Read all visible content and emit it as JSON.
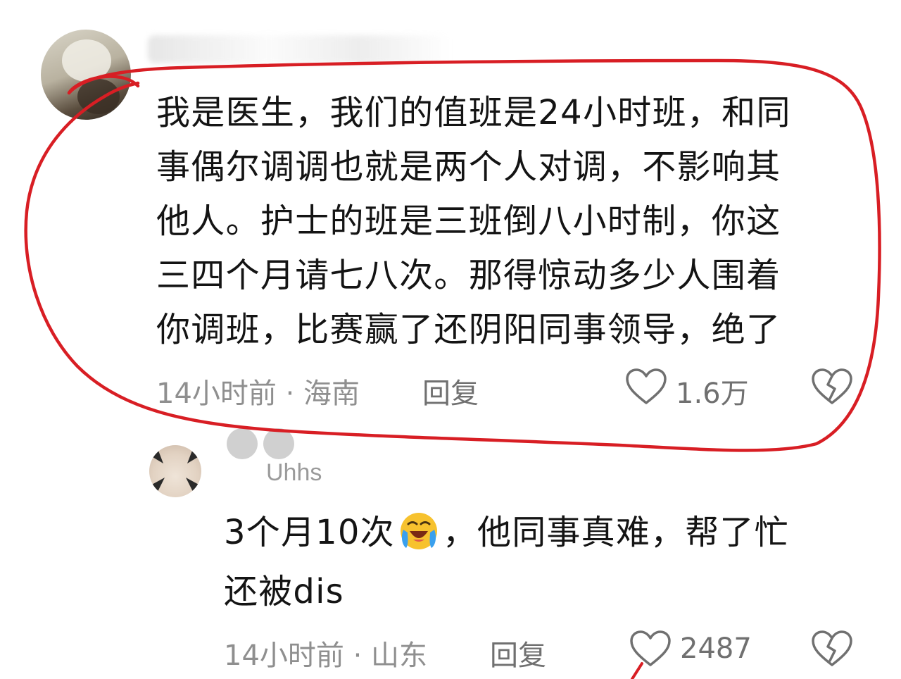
{
  "comment": {
    "lines": [
      "我是医生，我们的值班是24小时班，和同",
      "事偶尔调调也就是两个人对调，不影响其",
      "他人。护士的班是三班倒八小时制，你这",
      "三四个月请七八次。那得惊动多少人围着",
      "你调班，比赛赢了还阴阳同事领导，绝了"
    ],
    "time_location": "14小时前 · 海南",
    "reply_label": "回复",
    "like_count": "1.6万"
  },
  "reply": {
    "username_partial": "Uhhs",
    "line1_before": "3个月10次",
    "line1_after": "，他同事真难，帮了忙",
    "line2": "还被dis",
    "emoji": "crying-laughing-emoji",
    "time_location": "14小时前 · 山东",
    "reply_label": "回复",
    "like_count": "2487"
  },
  "colors": {
    "annotation": "#d81e24",
    "meta_text": "#8f8f8f",
    "body_text": "#141414"
  },
  "icons": [
    "heart-icon",
    "broken-heart-icon"
  ]
}
